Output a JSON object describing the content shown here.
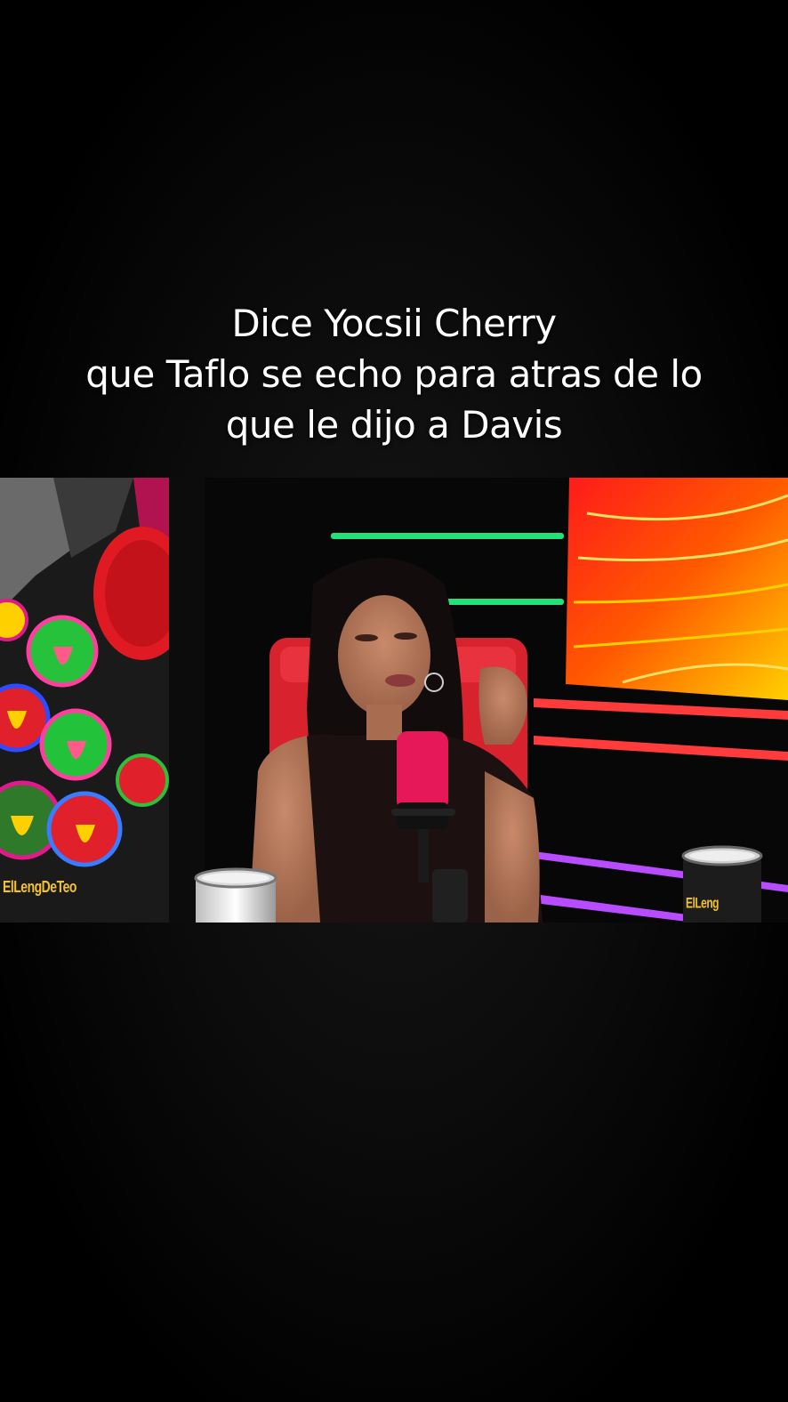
{
  "caption": {
    "line1": "Dice Yocsii Cherry",
    "line2": "que Taflo se echo para atras de lo",
    "line3": "que le dijo a Davis"
  },
  "video": {
    "watermark_left": "ElLengDeTeo",
    "watermark_right": "ElLeng",
    "colors": {
      "chair": "#d8232f",
      "mic": "#e6185a",
      "neon_green": "#22e07a",
      "neon_red": "#ff3b3b",
      "neon_purple": "#b84dff",
      "panel_orange": "#ff6a00"
    }
  }
}
